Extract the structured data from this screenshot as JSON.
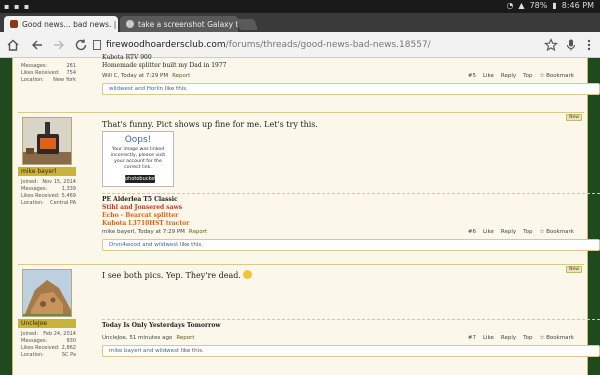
{
  "statusbar": {
    "left_text": "▪ ▪ ▪",
    "battery": "78%",
    "time": "8:46 PM"
  },
  "tabs": [
    {
      "label": "Good news... bad news. | Fi",
      "close": "×",
      "active": true
    },
    {
      "label": "take a screenshot Galaxy ta",
      "close": "×",
      "active": false
    }
  ],
  "toolbar": {
    "url_main": "firewoodhoardersclub.com",
    "url_path": "/forums/threads/good-news-bad-news.18557/"
  },
  "posts": [
    {
      "stats": [
        {
          "k": "Messages:",
          "v": "261"
        },
        {
          "k": "Likes Received:",
          "v": "754"
        },
        {
          "k": "Location:",
          "v": "New York"
        }
      ],
      "sig": [
        "Kubota RTV 900",
        "Homemade splitter built my Dad in 1977"
      ],
      "meta_author": "Will C, Today at 7:29 PM",
      "report": "Report",
      "num": "#5",
      "ctrl": [
        "Like",
        "Reply",
        "Top",
        "Bookmark"
      ],
      "likes": {
        "names": "wildwest and Horlin",
        "suffix": " like this."
      }
    },
    {
      "message": "That's funny. Pict shows up fine for me. Let's try this.",
      "username": "mike bayerl",
      "stats": [
        {
          "k": "Joined:",
          "v": "Nov 15, 2014"
        },
        {
          "k": "Messages:",
          "v": "1,339"
        },
        {
          "k": "Likes Received:",
          "v": "5,469"
        },
        {
          "k": "Location:",
          "v": "Central PA"
        }
      ],
      "oops": {
        "title": "Oops!",
        "body": "Your image was linked incorrectly, please visit your account for the correct link.",
        "logo": "photobucket"
      },
      "sig": [
        "PE Alderlea T5 Classic",
        "Stihl and Jonsered saws",
        "Echo - Bearcat splitter",
        "Kubota L3710HST tractor"
      ],
      "meta_author": "mike bayerl, Today at 7:29 PM",
      "report": "Report",
      "num": "#6",
      "ctrl": [
        "Like",
        "Reply",
        "Top",
        "Bookmark"
      ],
      "likes": {
        "names": "Drvn4wood and wildwest",
        "suffix": " like this."
      },
      "newtag": "New"
    },
    {
      "message": "I see both pics. Yep. They're dead.",
      "username": "UncleJoe",
      "stats": [
        {
          "k": "Joined:",
          "v": "Feb 24, 2014"
        },
        {
          "k": "Messages:",
          "v": "930"
        },
        {
          "k": "Likes Received:",
          "v": "2,862"
        },
        {
          "k": "Location:",
          "v": "SC Pa"
        }
      ],
      "sig": [
        "Today Is Only Yesterdays Tomorrow"
      ],
      "meta_author": "UncleJoe, 51 minutes ago",
      "report": "Report",
      "num": "#7",
      "ctrl": [
        "Like",
        "Reply",
        "Top",
        "Bookmark"
      ],
      "likes": {
        "names": "mike bayerl and wildwest",
        "suffix": " like this."
      },
      "newtag": "New"
    }
  ],
  "colors": {
    "forum_bg": "#fbf7ea",
    "page_bg": "#1e4a1e",
    "username_bar": "#c8b23a",
    "link": "#3a6a9a"
  }
}
